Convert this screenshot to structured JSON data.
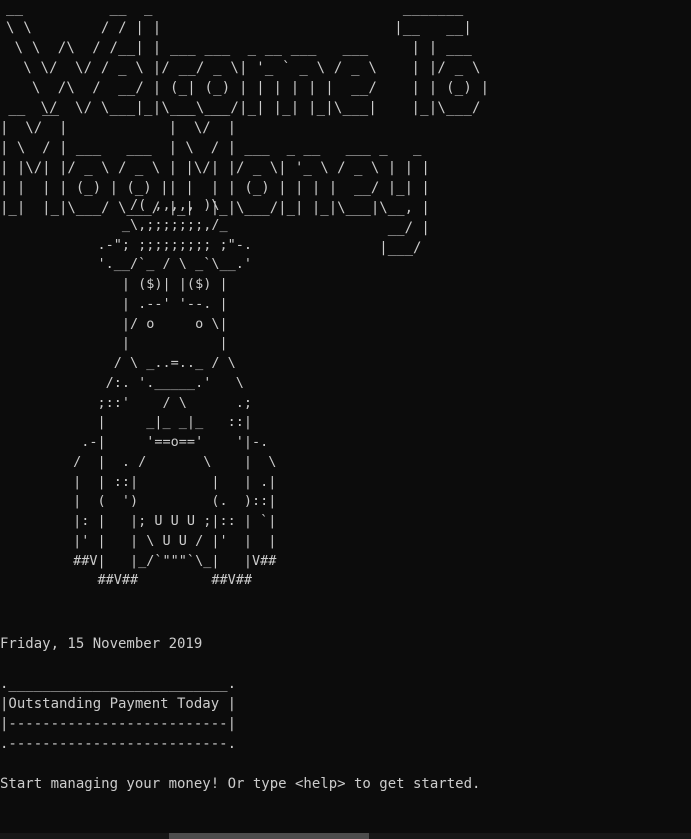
{
  "console": {
    "banner_welcome": "__          __  _                             _______\n\\ \\        / / | |                           |__   __|\n \\ \\  /\\  / /__| | ___ ___  _ __ ___   ___     | | ___\n  \\ \\/  \\/ / _ \\ |/ __/ _ \\| '_ ` _ \\ / _ \\    | |/ _ \\\n   \\  /\\  /  __/ | (_| (_) | | | | | |  __/    | | (_) |\n    \\/  \\/ \\___|_|\\___\\___/|_| |_| |_|\\___|    |_|\\___/",
    "banner_money": " __  __              __  __                       \n|  \\/  |            |  \\/  |                      \n| \\  / | ___   ___  | \\  / | ___  _ __   ___ _   _\n| |\\/| |/ _ \\ / _ \\ | |\\/| |/ _ \\| '_ \\ / _ \\ | | |\n| |  | | (_) | (_) || |  | | (_) | | | |  __/ |_| |\n|_|  |_|\\___/ \\___/ |_|  |_|\\___/|_| |_|\\___|\\__, |\n                                              __/ |\n                                             |___/",
    "mascot": "                /( ,,,,, )\\\n               _\\,;;;;;;;,/_\n            .-\"; ;;;;;;;;; ;\"-.\n            '.__/`_ / \\ _`\\__.'\n               | ($)| |($) |\n               | .--' '--. |\n               |/ o     o \\|\n               |           |\n              / \\ _..=.._ / \\\n             /:. '._____.'   \\\n            ;::'    / \\      .;\n            |     _|_ _|_   ::|\n          .-|     '==o=='    '|-.\n         /  |  . /       \\    |  \\\n         |  | ::|         |   | .|\n         |  (  ')         (.  )::|\n         |: |   |; U U U ;|:: | `|\n         |' |   | \\ U U / |'  |  |\n         ##V|   |_/`\"\"\"`\\_|   |V##\n            ##V##         ##V##",
    "date_line": "Friday, 15 November 2019",
    "payment_box": ".__________________________.\n|Outstanding Payment Today |\n|--------------------------|\n.--------------------------.",
    "prompt_line": "Start managing your money! Or type <help> to get started."
  }
}
